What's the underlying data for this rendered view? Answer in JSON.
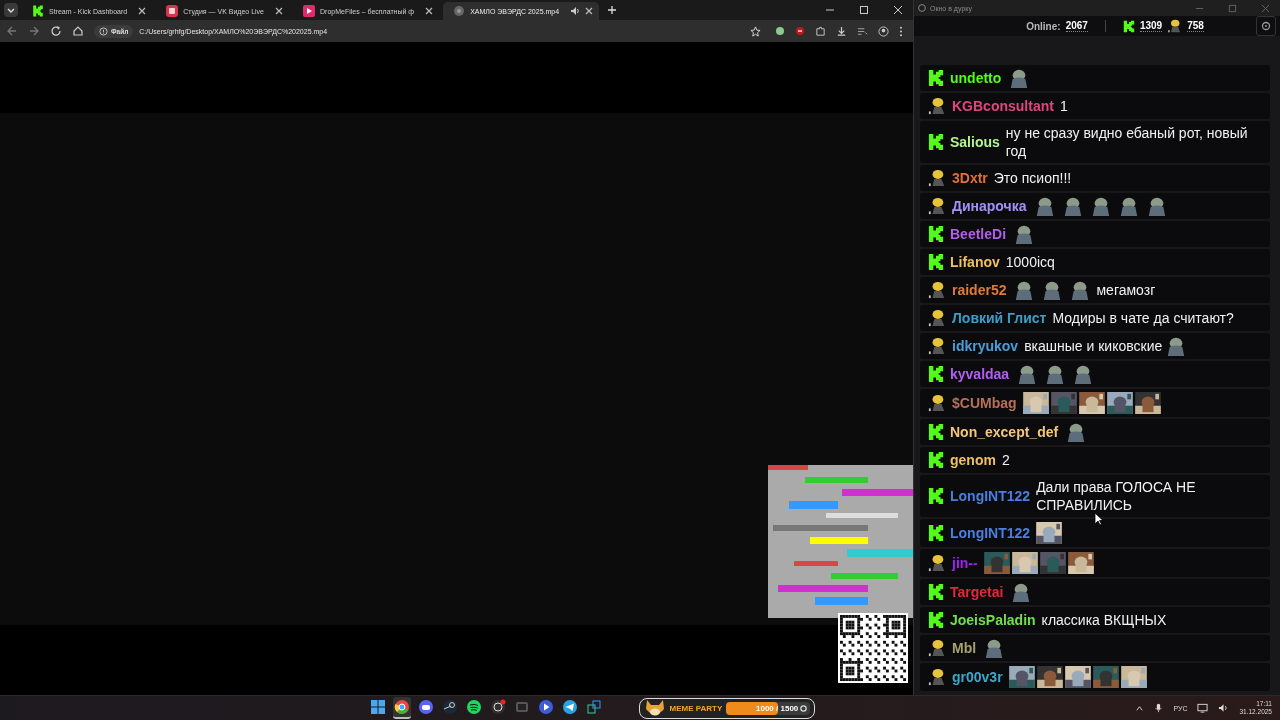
{
  "browser": {
    "tabs": [
      {
        "title": "Stream - Kick Dashboard",
        "kind": "kick",
        "selected": false
      },
      {
        "title": "Студия — VK Видео Live",
        "kind": "vk",
        "selected": false
      },
      {
        "title": "DropMeFiles – бесплатный ф",
        "kind": "drop",
        "selected": false
      },
      {
        "title": "ХАМЛО ЭВЭРДС 2025.mp4",
        "kind": "file",
        "selected": true
      }
    ],
    "address": {
      "chip": "Файл",
      "url": "C:/Users/grhfg/Desktop/ХАМЛО%20ЭВЭРДС%202025.mp4"
    }
  },
  "chat": {
    "window": {
      "title": "Окно в дурку"
    },
    "stats": {
      "online_label": "Online:",
      "online": "2067",
      "kick_count": "1309",
      "vk_count": "758"
    },
    "messages": [
      {
        "kind": "kick",
        "user": "undetto",
        "color": "#53fc18",
        "content": [
          {
            "kind": "emote"
          }
        ]
      },
      {
        "kind": "vk",
        "user": "KGBconsultant",
        "color": "#e0457b",
        "content": [
          {
            "kind": "text",
            "text": "1"
          }
        ]
      },
      {
        "kind": "kick",
        "user": "Salious",
        "color": "#b6f58f",
        "content": [
          {
            "kind": "text",
            "text": "ну не сразу видно ебаный рот, новый год"
          }
        ]
      },
      {
        "kind": "vk",
        "user": "3Dxtr",
        "color": "#e0703a",
        "content": [
          {
            "kind": "text",
            "text": "Это псиоп!!!"
          }
        ]
      },
      {
        "kind": "vk",
        "user": "Динарочка",
        "color": "#a191f7",
        "content": [
          {
            "kind": "emote"
          },
          {
            "kind": "emote"
          },
          {
            "kind": "emote"
          },
          {
            "kind": "emote"
          },
          {
            "kind": "emote"
          }
        ]
      },
      {
        "kind": "kick",
        "user": "BeetleDi",
        "color": "#b15ee8",
        "content": [
          {
            "kind": "emote"
          }
        ]
      },
      {
        "kind": "kick",
        "user": "Lifanov",
        "color": "#f0c060",
        "content": [
          {
            "kind": "text",
            "text": "1000icq"
          }
        ]
      },
      {
        "kind": "vk",
        "user": "raider52",
        "color": "#e07a3a",
        "content": [
          {
            "kind": "emote"
          },
          {
            "kind": "emote"
          },
          {
            "kind": "emote"
          },
          {
            "kind": "text",
            "text": "мегамозг"
          }
        ]
      },
      {
        "kind": "vk",
        "user": "Ловкий Глист",
        "color": "#3a9fc8",
        "content": [
          {
            "kind": "text",
            "text": "Модиры в чате да считают?"
          }
        ]
      },
      {
        "kind": "vk",
        "user": "idkryukov",
        "color": "#4a9ed6",
        "content": [
          {
            "kind": "text",
            "text": "вкашные и киковские"
          },
          {
            "kind": "emote"
          }
        ]
      },
      {
        "kind": "kick",
        "user": "kyvaldaa",
        "color": "#b25ef0",
        "content": [
          {
            "kind": "emote"
          },
          {
            "kind": "emote"
          },
          {
            "kind": "emote"
          }
        ]
      },
      {
        "kind": "vk",
        "user": "$CUMbag",
        "color": "#b8705a"
      },
      {
        "kind": "kick",
        "user": "Non_except_def",
        "color": "#f5c77a",
        "content": [
          {
            "kind": "emote"
          }
        ]
      },
      {
        "kind": "kick",
        "user": "genom",
        "color": "#f0c060",
        "content": [
          {
            "kind": "text",
            "text": "2"
          }
        ]
      },
      {
        "kind": "kick",
        "user": "LongINT122",
        "color": "#4a7fe0",
        "content": [
          {
            "kind": "text",
            "text": "Дали права ГОЛОСА НЕ СПРАВИЛИСЬ"
          }
        ]
      },
      {
        "kind": "kick",
        "user": "LongINT122",
        "color": "#4a7fe0"
      },
      {
        "kind": "vk",
        "user": "jin--",
        "color": "#a020f0"
      },
      {
        "kind": "kick",
        "user": "Targetai",
        "color": "#e02a3a",
        "content": [
          {
            "kind": "emote"
          }
        ]
      },
      {
        "kind": "kick",
        "user": "JoeisPaladin",
        "color": "#6fe04a",
        "content": [
          {
            "kind": "text",
            "text": "классика ВКЩНЫХ"
          }
        ]
      },
      {
        "kind": "vk",
        "user": "Mbl",
        "color": "#a3a36e",
        "content": [
          {
            "kind": "emote"
          }
        ]
      },
      {
        "kind": "vk",
        "user": "gr00v3r",
        "color": "#3aa8c8"
      }
    ]
  },
  "taskbar": {
    "apps": [
      {
        "kind": "windows",
        "active": false
      },
      {
        "kind": "chrome",
        "active": true
      },
      {
        "kind": "discord",
        "active": false
      },
      {
        "kind": "steam",
        "active": false
      },
      {
        "kind": "spotify",
        "active": false
      },
      {
        "kind": "obs",
        "active": false
      },
      {
        "kind": "window",
        "active": false
      },
      {
        "kind": "player",
        "active": false
      },
      {
        "kind": "telegram",
        "active": false
      },
      {
        "kind": "tool",
        "active": false
      }
    ],
    "widget": {
      "title": "MEME PARTY",
      "progress": "1000 / 1500",
      "level": 0.62
    },
    "tray": {
      "language": "РУС",
      "time": "17:11",
      "date": "31.12.2025"
    }
  }
}
